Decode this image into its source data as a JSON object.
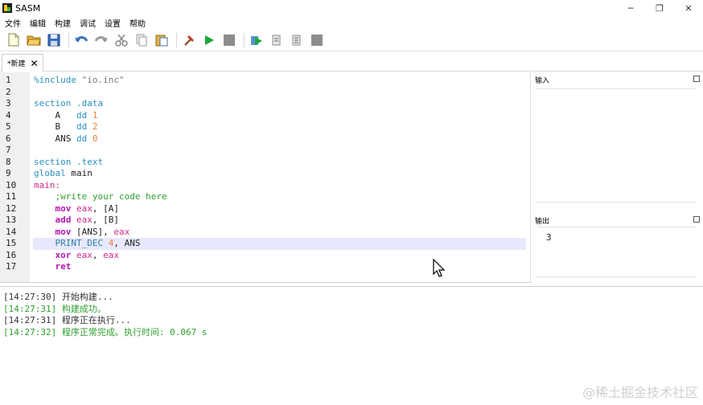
{
  "window": {
    "title": "SASM",
    "minimize": "─",
    "restore": "❐",
    "close": "✕"
  },
  "menu": [
    "文件",
    "编辑",
    "构建",
    "调试",
    "设置",
    "帮助"
  ],
  "toolbar": {
    "buttons": [
      "new-file",
      "open-file",
      "save-file",
      "undo",
      "redo",
      "cut",
      "copy",
      "paste",
      "build",
      "run",
      "stop",
      "debug",
      "step-over",
      "step-into",
      "debug-stop"
    ]
  },
  "tab": {
    "label": "*新建",
    "close": "✕"
  },
  "editor": {
    "line_numbers": [
      "1",
      "2",
      "3",
      "4",
      "5",
      "6",
      "7",
      "8",
      "9",
      "10",
      "11",
      "12",
      "13",
      "14",
      "15",
      "16",
      "17"
    ],
    "highlighted_line": 15,
    "lines": [
      [
        {
          "t": "%include ",
          "c": "dir"
        },
        {
          "t": "\"io.inc\"",
          "c": "str"
        }
      ],
      [],
      [
        {
          "t": "section .data",
          "c": "dir"
        }
      ],
      [
        {
          "t": "    A   ",
          "c": "id"
        },
        {
          "t": "dd ",
          "c": "typ"
        },
        {
          "t": "1",
          "c": "num"
        }
      ],
      [
        {
          "t": "    B   ",
          "c": "id"
        },
        {
          "t": "dd ",
          "c": "typ"
        },
        {
          "t": "2",
          "c": "num"
        }
      ],
      [
        {
          "t": "    ANS ",
          "c": "id"
        },
        {
          "t": "dd ",
          "c": "typ"
        },
        {
          "t": "0",
          "c": "num"
        }
      ],
      [],
      [
        {
          "t": "section .text",
          "c": "dir"
        }
      ],
      [
        {
          "t": "global ",
          "c": "dir"
        },
        {
          "t": "main",
          "c": "id"
        }
      ],
      [
        {
          "t": "main:",
          "c": "lbl"
        }
      ],
      [
        {
          "t": "    ;write your code here",
          "c": "cmt"
        }
      ],
      [
        {
          "t": "    ",
          "c": "id"
        },
        {
          "t": "mov ",
          "c": "kw"
        },
        {
          "t": "eax",
          "c": "reg"
        },
        {
          "t": ", [A]",
          "c": "id"
        }
      ],
      [
        {
          "t": "    ",
          "c": "id"
        },
        {
          "t": "add ",
          "c": "kw"
        },
        {
          "t": "eax",
          "c": "reg"
        },
        {
          "t": ", [B]",
          "c": "id"
        }
      ],
      [
        {
          "t": "    ",
          "c": "id"
        },
        {
          "t": "mov ",
          "c": "kw"
        },
        {
          "t": "[ANS], ",
          "c": "id"
        },
        {
          "t": "eax",
          "c": "reg"
        }
      ],
      [
        {
          "t": "    PRINT_DEC ",
          "c": "mac"
        },
        {
          "t": "4",
          "c": "num"
        },
        {
          "t": ", ANS",
          "c": "id"
        }
      ],
      [
        {
          "t": "    ",
          "c": "id"
        },
        {
          "t": "xor ",
          "c": "kw"
        },
        {
          "t": "eax",
          "c": "reg"
        },
        {
          "t": ", ",
          "c": "id"
        },
        {
          "t": "eax",
          "c": "reg"
        }
      ],
      [
        {
          "t": "    ",
          "c": "id"
        },
        {
          "t": "ret",
          "c": "kw"
        }
      ]
    ]
  },
  "input_panel": {
    "title": "输入"
  },
  "output_panel": {
    "title": "输出",
    "value": "3"
  },
  "log": [
    {
      "text": "[14:27:30] 开始构建...",
      "status": "normal"
    },
    {
      "text": "[14:27:31] 构建成功。",
      "status": "ok"
    },
    {
      "text": "[14:27:31] 程序正在执行...",
      "status": "normal"
    },
    {
      "text": "[14:27:32] 程序正常完成。执行时间: 0.067 s",
      "status": "ok"
    }
  ],
  "watermark": "@稀土掘金技术社区",
  "colors": {
    "highlight_line": "#e8e8ff",
    "success": "#2f9e2f",
    "keyword": "#b316b3",
    "directive": "#2a8fbd"
  }
}
